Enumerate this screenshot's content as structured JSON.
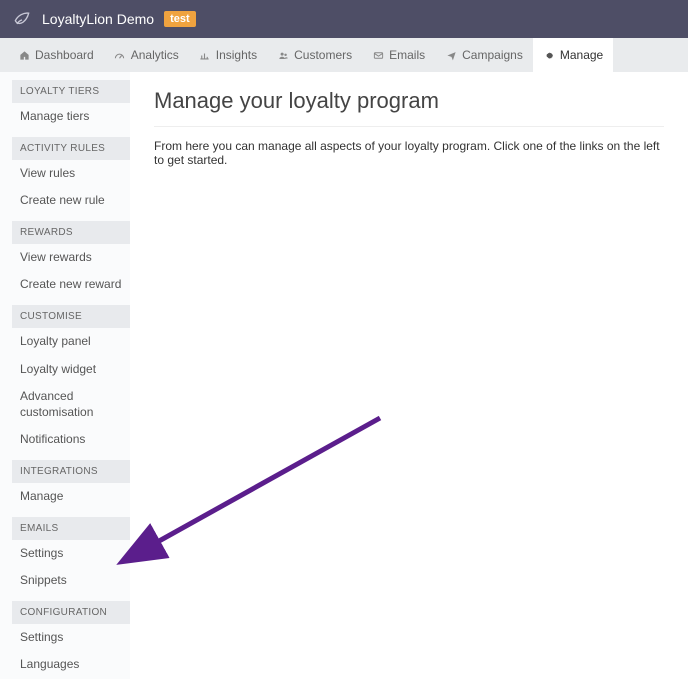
{
  "header": {
    "brand": "LoyaltyLion Demo",
    "badge": "test"
  },
  "nav": {
    "items": [
      {
        "label": "Dashboard"
      },
      {
        "label": "Analytics"
      },
      {
        "label": "Insights"
      },
      {
        "label": "Customers"
      },
      {
        "label": "Emails"
      },
      {
        "label": "Campaigns"
      },
      {
        "label": "Manage"
      }
    ],
    "active_index": 6
  },
  "sidebar": {
    "sections": [
      {
        "header": "LOYALTY TIERS",
        "items": [
          "Manage tiers"
        ]
      },
      {
        "header": "ACTIVITY RULES",
        "items": [
          "View rules",
          "Create new rule"
        ]
      },
      {
        "header": "REWARDS",
        "items": [
          "View rewards",
          "Create new reward"
        ]
      },
      {
        "header": "CUSTOMISE",
        "items": [
          "Loyalty panel",
          "Loyalty widget",
          "Advanced customisation",
          "Notifications"
        ]
      },
      {
        "header": "INTEGRATIONS",
        "items": [
          "Manage"
        ]
      },
      {
        "header": "EMAILS",
        "items": [
          "Settings",
          "Snippets"
        ]
      },
      {
        "header": "CONFIGURATION",
        "items": [
          "Settings",
          "Languages"
        ]
      }
    ]
  },
  "main": {
    "title": "Manage your loyalty program",
    "description": "From here you can manage all aspects of your loyalty program. Click one of the links on the left to get started."
  },
  "annotation": {
    "arrow_color": "#5b1e8c"
  }
}
